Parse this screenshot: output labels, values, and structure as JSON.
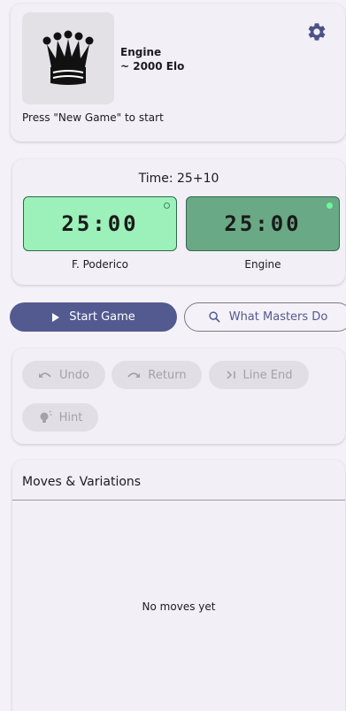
{
  "engine": {
    "name": "Engine",
    "elo": "~ 2000 Elo",
    "avatar_icon": "queen-icon",
    "status": "Press \"New Game\" to start"
  },
  "settings": {
    "icon": "gear-icon"
  },
  "clocks": {
    "time_control": "Time: 25+10",
    "white": {
      "time": "25:00",
      "player": "F. Poderico",
      "color": "#9cf0b9"
    },
    "black": {
      "time": "25:00",
      "player": "Engine",
      "color": "#6aa985"
    }
  },
  "actions": {
    "start_label": "Start Game",
    "start_icon": "play-icon",
    "masters_label": "What Masters Do",
    "masters_icon": "search-icon",
    "accent_color": "#525a90"
  },
  "controls": {
    "undo_label": "Undo",
    "undo_icon": "undo-icon",
    "return_label": "Return",
    "return_icon": "redo-icon",
    "lineend_label": "Line End",
    "lineend_icon": "skip-end-icon",
    "hint_label": "Hint",
    "hint_icon": "lightbulb-icon"
  },
  "moves": {
    "title": "Moves & Variations",
    "empty_text": "No moves yet"
  }
}
